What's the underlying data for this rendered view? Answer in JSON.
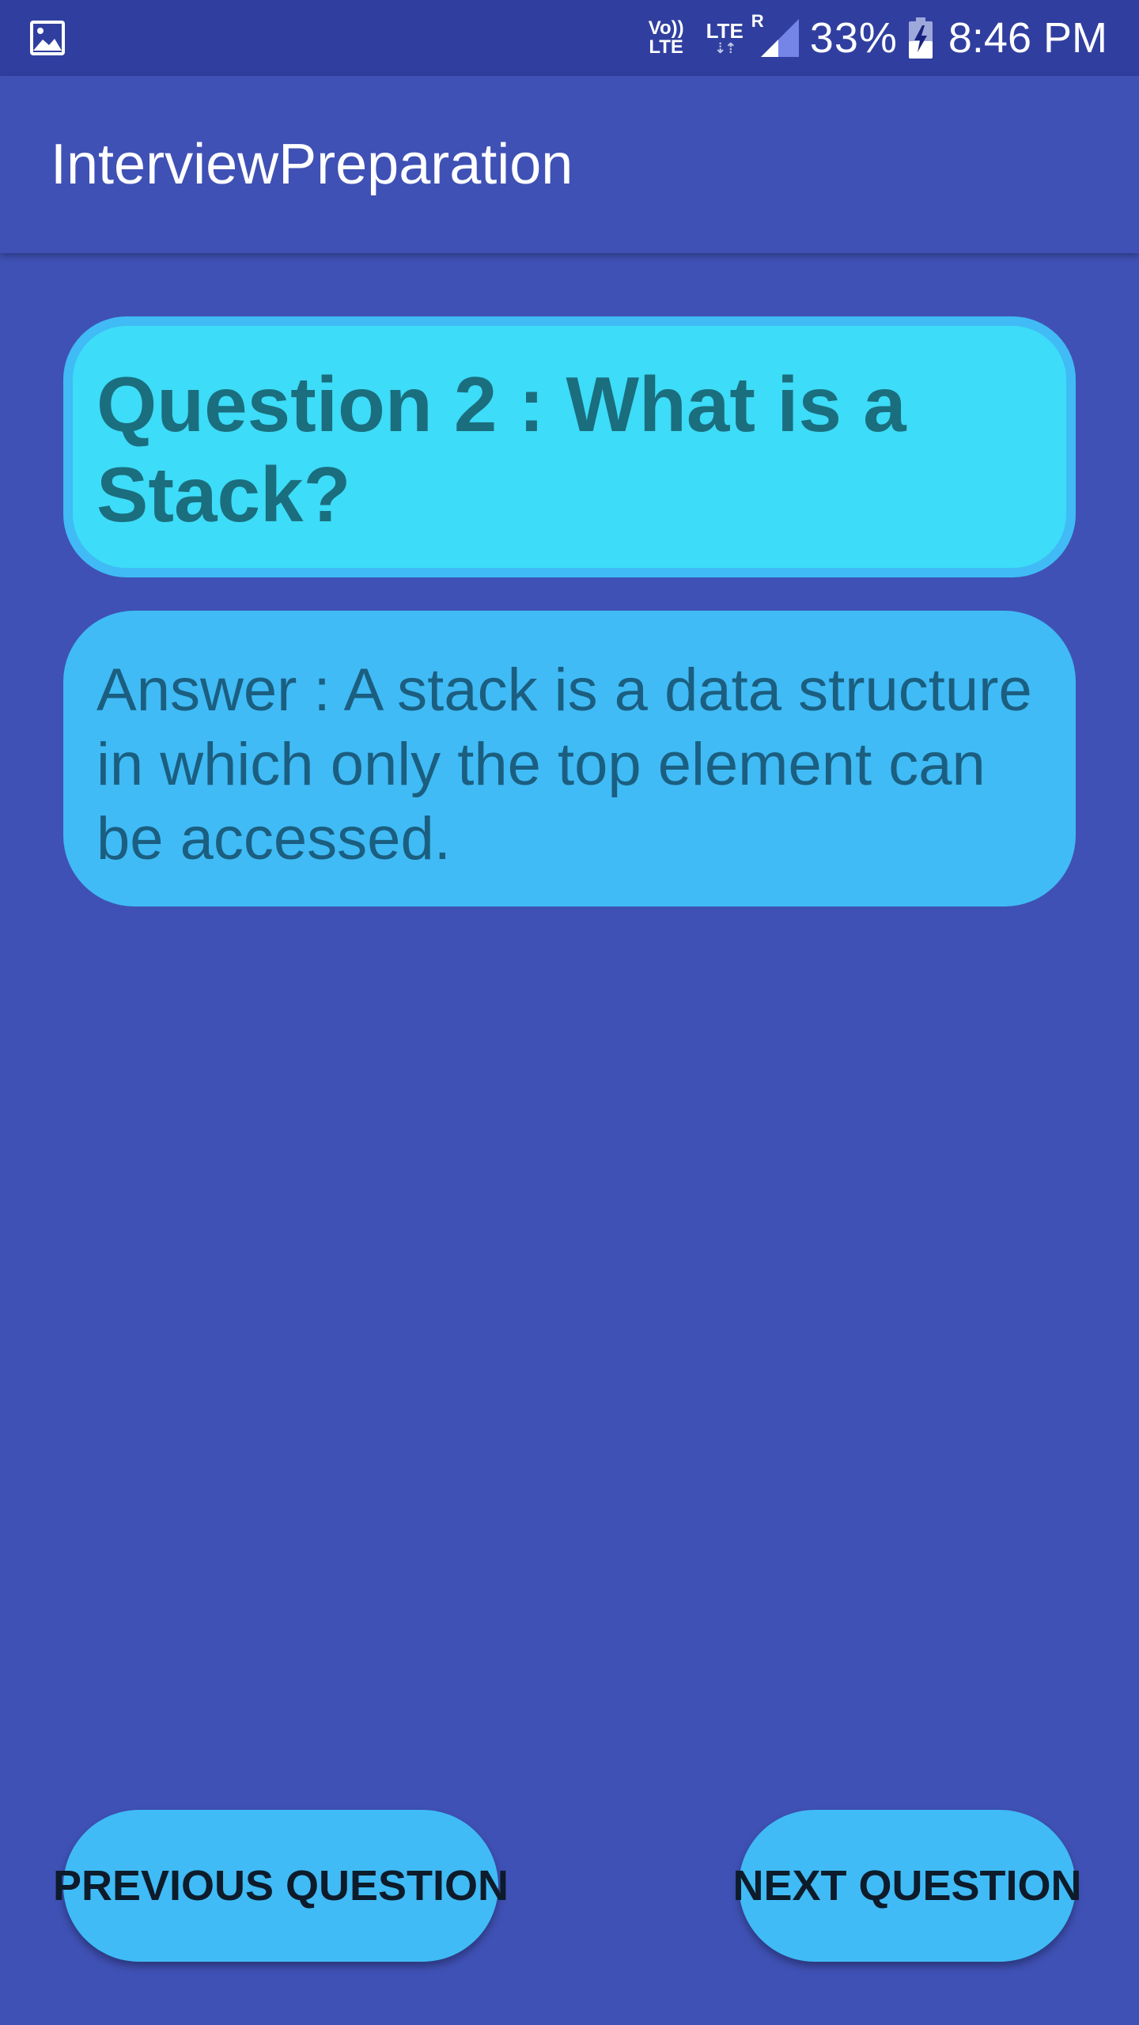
{
  "status_bar": {
    "left_icon": "image-icon",
    "volte_top": "Vo))",
    "volte_bottom": "LTE",
    "lte": "LTE",
    "lte_arrows": "⇣⇡",
    "roaming": "R",
    "signal_icon": "signal-icon",
    "battery_percent": "33%",
    "battery_icon": "battery-charging-icon",
    "time": "8:46 PM"
  },
  "app_bar": {
    "title": "InterviewPreparation"
  },
  "question": {
    "text": "Question 2 : What is a Stack?"
  },
  "answer": {
    "text": "Answer : A stack is a data structure in which only the top element can be accessed."
  },
  "buttons": {
    "previous": "PREVIOUS QUESTION",
    "next": "NEXT QUESTION"
  },
  "colors": {
    "background": "#3F51B5",
    "status_bar": "#303F9F",
    "question_fill": "#3DDCF8",
    "card_blue": "#40BBF5",
    "question_text": "#1B6E7E",
    "answer_text": "#1B5E80"
  }
}
